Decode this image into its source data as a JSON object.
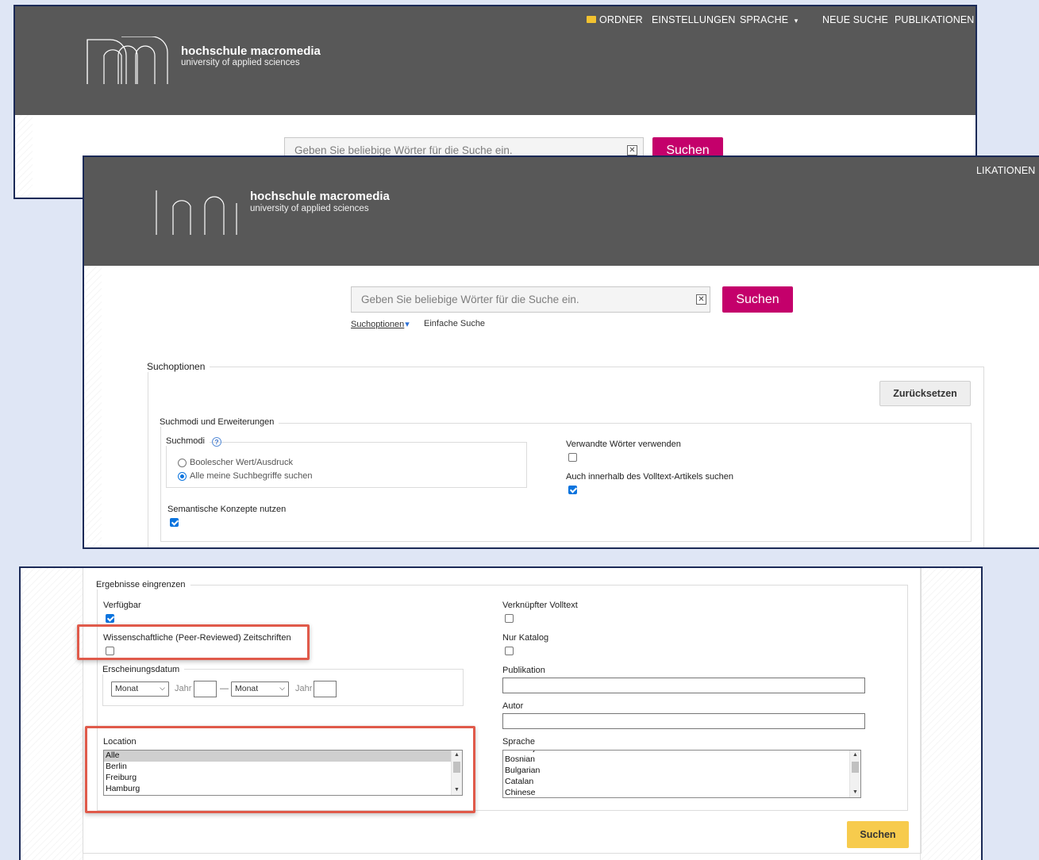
{
  "colors": {
    "header_bg": "#585858",
    "brand": "#c4006b",
    "accent": "#f7cb4d",
    "annotation": "#e05a4a",
    "checkbox": "#0b74de"
  },
  "nav": {
    "folder": "ORDNER",
    "settings": "EINSTELLUNGEN",
    "language": "SPRACHE",
    "language_caret": "▾",
    "new_search": "NEUE SUCHE",
    "publications": "PUBLIKATIONEN",
    "publications_clipped": "LIKATIONEN",
    "folder_icon": "folder-icon"
  },
  "logo": {
    "name": "hochschule macromedia",
    "subtitle": "university of applied sciences"
  },
  "search": {
    "placeholder": "Geben Sie beliebige Wörter für die Suche ein.",
    "clear": "✕",
    "button": "Suchen",
    "options_link": "Suchoptionen",
    "options_caret": "▾",
    "simple_link": "Einfache Suche"
  },
  "options": {
    "title": "Suchoptionen",
    "reset": "Zurücksetzen",
    "modes_group": "Suchmodi und Erweiterungen",
    "modes_label": "Suchmodi",
    "help": "?",
    "mode_boolean": "Boolescher Wert/Ausdruck",
    "mode_all": "Alle meine Suchbegriffe suchen",
    "related_words": "Verwandte Wörter verwenden",
    "fulltext_search": "Auch innerhalb des Volltext-Artikels suchen",
    "semantic": "Semantische Konzepte nutzen"
  },
  "limits": {
    "title": "Ergebnisse eingrenzen",
    "available": "Verfügbar",
    "peer_reviewed": "Wissenschaftliche (Peer-Reviewed) Zeitschriften",
    "date_group": "Erscheinungsdatum",
    "month": "Monat",
    "year": "Jahr",
    "dash": "—",
    "location": "Location",
    "locations": [
      "Alle",
      "Berlin",
      "Freiburg",
      "Hamburg"
    ],
    "linked_fulltext": "Verknüpfter Volltext",
    "catalog_only": "Nur Katalog",
    "publication": "Publikation",
    "author": "Autor",
    "language": "Sprache",
    "languages": [
      "Azerbaijani",
      "Bosnian",
      "Bulgarian",
      "Catalan",
      "Chinese"
    ],
    "search_button": "Suchen"
  }
}
